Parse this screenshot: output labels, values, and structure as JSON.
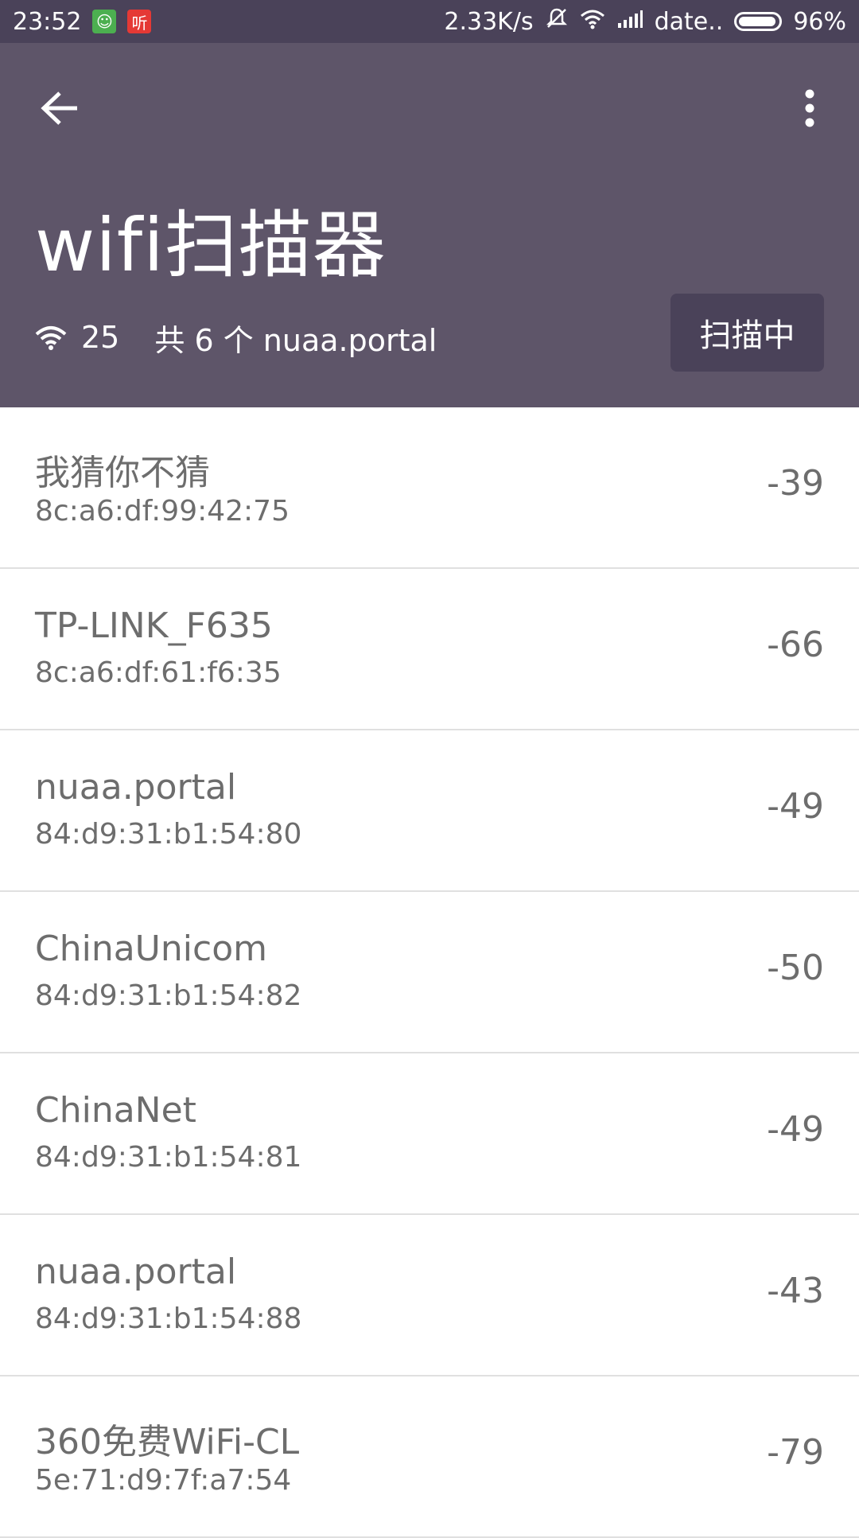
{
  "status_bar": {
    "time": "23:52",
    "notif_icons": [
      "android-icon",
      "listen-icon"
    ],
    "notif_labels": [
      "",
      "听"
    ],
    "net_speed": "2.33K/s",
    "carrier": "date..",
    "battery": "96%",
    "battery_level": 0.96
  },
  "header": {
    "title": "wifi扫描器",
    "wifi_count": "25",
    "summary": "共 6 个 nuaa.portal",
    "scan_button": "扫描中",
    "color": "#5e5569",
    "dark_color": "#4a4259"
  },
  "networks": [
    {
      "ssid": "我猜你不猜",
      "bssid": "8c:a6:df:99:42:75",
      "rssi": "-39"
    },
    {
      "ssid": "TP-LINK_F635",
      "bssid": "8c:a6:df:61:f6:35",
      "rssi": "-66"
    },
    {
      "ssid": "nuaa.portal",
      "bssid": "84:d9:31:b1:54:80",
      "rssi": "-49"
    },
    {
      "ssid": "ChinaUnicom",
      "bssid": "84:d9:31:b1:54:82",
      "rssi": "-50"
    },
    {
      "ssid": "ChinaNet",
      "bssid": "84:d9:31:b1:54:81",
      "rssi": "-49"
    },
    {
      "ssid": "nuaa.portal",
      "bssid": "84:d9:31:b1:54:88",
      "rssi": "-43"
    },
    {
      "ssid": "360免费WiFi-CL",
      "bssid": "5e:71:d9:7f:a7:54",
      "rssi": "-79"
    }
  ]
}
